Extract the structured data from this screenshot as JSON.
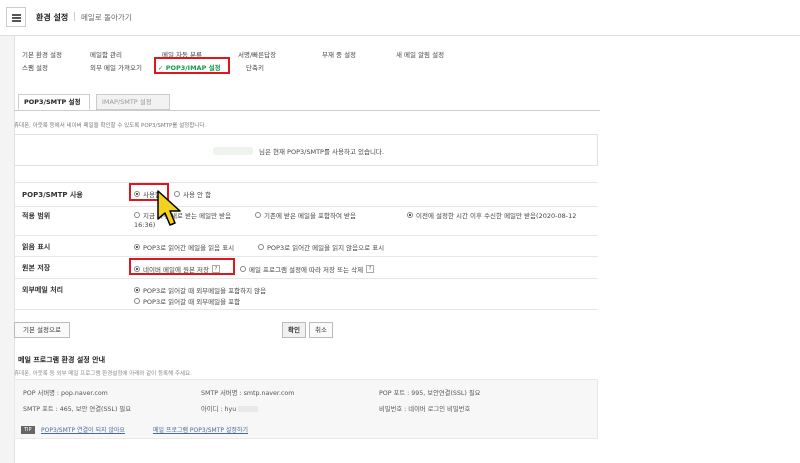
{
  "topbar": {
    "title": "환경 설정",
    "back_link": "메일로 돌아가기"
  },
  "settings_tabs": [
    "기본 환경 설정",
    "메일함 관리",
    "메일 자동 분류",
    "서명/빠른답장",
    "부재 중 설정",
    "새 메일 알림 설정",
    "스팸 설정",
    "외부 메일 가져오기",
    "POP3/IMAP 설정",
    "단축키"
  ],
  "active_tab_check": "✓",
  "subtabs": [
    "POP3/SMTP 설정",
    "IMAP/SMTP 설정"
  ],
  "description": "휴대폰, 아웃룩 등에서 네이버 메일을 확인할 수 있도록 POP3/SMTP를 설정합니다.",
  "notice": "님은 현재 POP3/SMTP를 사용하고 있습니다.",
  "form": {
    "use": {
      "label": "POP3/SMTP 사용",
      "options": [
        "사용함",
        "사용 안 함"
      ]
    },
    "scope": {
      "label": "적용 범위",
      "options": [
        "지금 이후 새로 받는 메일만 받음",
        "기존에 받은 메일을 포함하여 받음",
        "이전에 설정한 시간 이후 수신한 메일만 받음(2020-08-12",
        "16:36)"
      ]
    },
    "read": {
      "label": "읽음 표시",
      "options": [
        "POP3로 읽어간 메일을 읽음 표시",
        "POP3로 읽어간 메일을 읽지 않음으로 표시"
      ]
    },
    "keep": {
      "label": "원본 저장",
      "options": [
        "네이버 메일에 원본 저장",
        "메일 프로그램 설정에 따라 저장 또는 삭제"
      ],
      "help": "?"
    },
    "external": {
      "label": "외부메일 처리",
      "options": [
        "POP3로 읽어갈 때 외부메일을 포함하지 않음",
        "POP3로 읽어갈 때 외부메일을 포함"
      ]
    }
  },
  "buttons": {
    "reset": "기본 설정으로",
    "confirm": "확인",
    "cancel": "취소"
  },
  "guide": {
    "title": "메일 프로그램 환경 설정 안내",
    "desc": "휴대폰, 아웃룩 등 외부 메일 프로그램 환경설정에 아래와 같이 등록해 주세요.",
    "pop_server": "POP 서버명 : pop.naver.com",
    "smtp_server": "SMTP 서버명 : smtp.naver.com",
    "pop_port": "POP 포트 : 995, 보안연결(SSL) 필요",
    "smtp_port": "SMTP 포트 : 465, 보안 연결(SSL) 필요",
    "id": "아이디 : hyu",
    "password": "비밀번호 : 네이버 로그인 비밀번호",
    "tip": "TIP",
    "link1": "POP3/SMTP 연결이 되지 않아요",
    "link2": "메일 프로그램 POP3/SMTP 설정하기"
  },
  "colors": {
    "accent_green": "#13a04a",
    "highlight_red": "#e0161e",
    "cursor_yellow": "#f2d21e"
  }
}
